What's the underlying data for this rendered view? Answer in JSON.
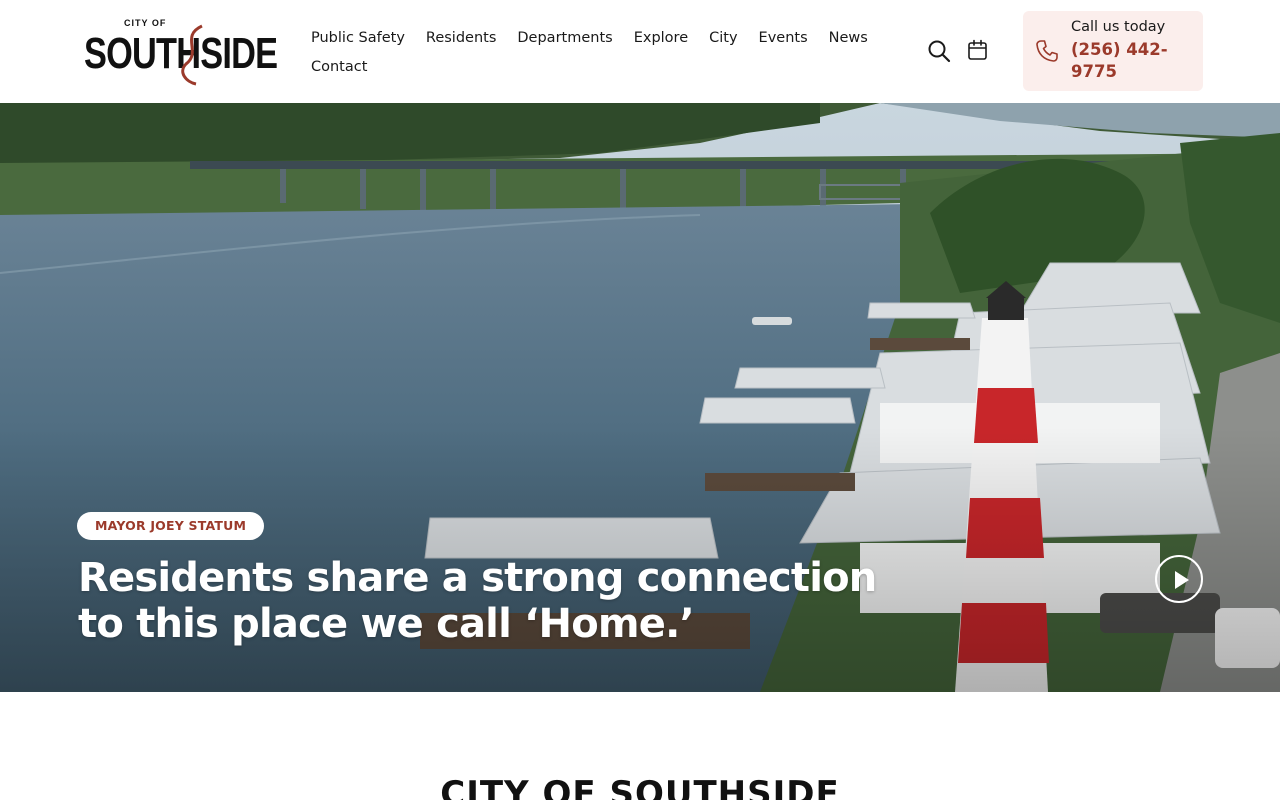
{
  "header": {
    "logo": {
      "small_text": "CITY OF",
      "big_text": "SOUTHSIDE"
    },
    "nav": [
      {
        "label": "Public Safety"
      },
      {
        "label": "Residents"
      },
      {
        "label": "Departments"
      },
      {
        "label": "Explore"
      },
      {
        "label": "City"
      },
      {
        "label": "Events"
      },
      {
        "label": "News"
      },
      {
        "label": "Contact"
      }
    ],
    "icons": {
      "search": "search-icon",
      "calendar": "calendar-icon",
      "phone": "phone-icon"
    },
    "call": {
      "label": "Call us today",
      "number": "(256) 442-9775"
    }
  },
  "hero": {
    "badge": "MAYOR JOEY STATUM",
    "headline": "Residents share a strong connection to this place we call ‘Home.’",
    "play_icon": "play-icon"
  },
  "section": {
    "title": "CITY OF SOUTHSIDE"
  },
  "colors": {
    "accent": "#9b3a2b",
    "call_bg": "#fbeeec",
    "text": "#1a1a1a"
  }
}
